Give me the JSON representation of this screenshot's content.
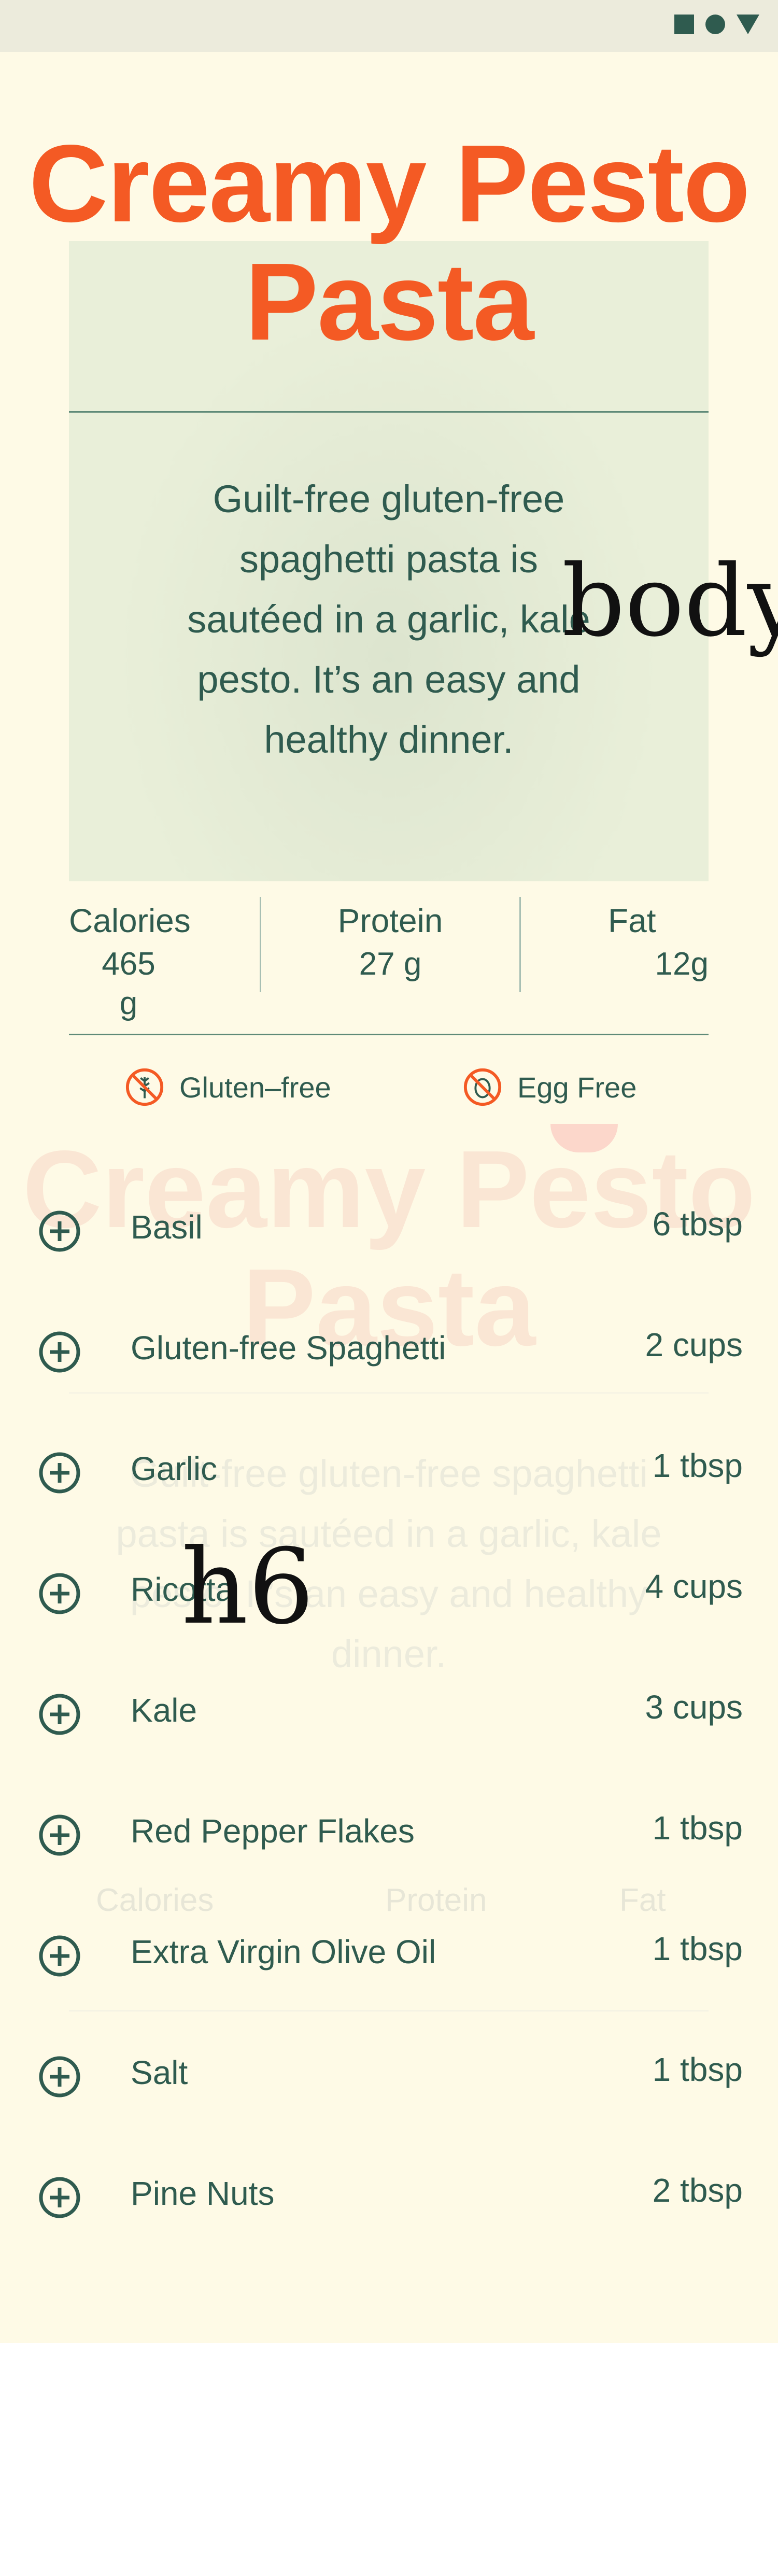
{
  "status_bar": {
    "icons": [
      "square-icon",
      "circle-icon",
      "triangle-icon"
    ]
  },
  "recipe": {
    "title_line1": "Creamy Pesto",
    "title_line2": "Pasta",
    "description": "Guilt-free gluten-free spaghetti pasta is sautéed in a garlic, kale pesto. It’s an easy and healthy dinner.",
    "nutrition": [
      {
        "label": "Calories",
        "value": "465 g"
      },
      {
        "label": "Protein",
        "value": "27 g"
      },
      {
        "label": "Fat",
        "value": "12g"
      }
    ],
    "tags": [
      {
        "label": "Gluten–free",
        "icon": "no-wheat-icon"
      },
      {
        "label": "Egg Free",
        "icon": "no-egg-icon"
      }
    ],
    "ingredients": [
      {
        "name": "Basil",
        "amount": "6 tbsp"
      },
      {
        "name": "Gluten-free Spaghetti",
        "amount": "2 cups"
      },
      {
        "name": "Garlic",
        "amount": "1 tbsp"
      },
      {
        "name": "Ricotta",
        "amount": "4 cups"
      },
      {
        "name": "Kale",
        "amount": "3 cups"
      },
      {
        "name": "Red Pepper Flakes",
        "amount": "1 tbsp"
      },
      {
        "name": "Extra Virgin Olive Oil",
        "amount": "1 tbsp"
      },
      {
        "name": "Salt",
        "amount": "1 tbsp"
      },
      {
        "name": "Pine Nuts",
        "amount": "2 tbsp"
      }
    ]
  },
  "debug_labels": {
    "body": "body",
    "h6": "h6"
  },
  "colors": {
    "accent": "#f45a24",
    "primary_text": "#2f5b4f",
    "background": "#fefae6",
    "hero_background": "#e9efd9"
  }
}
